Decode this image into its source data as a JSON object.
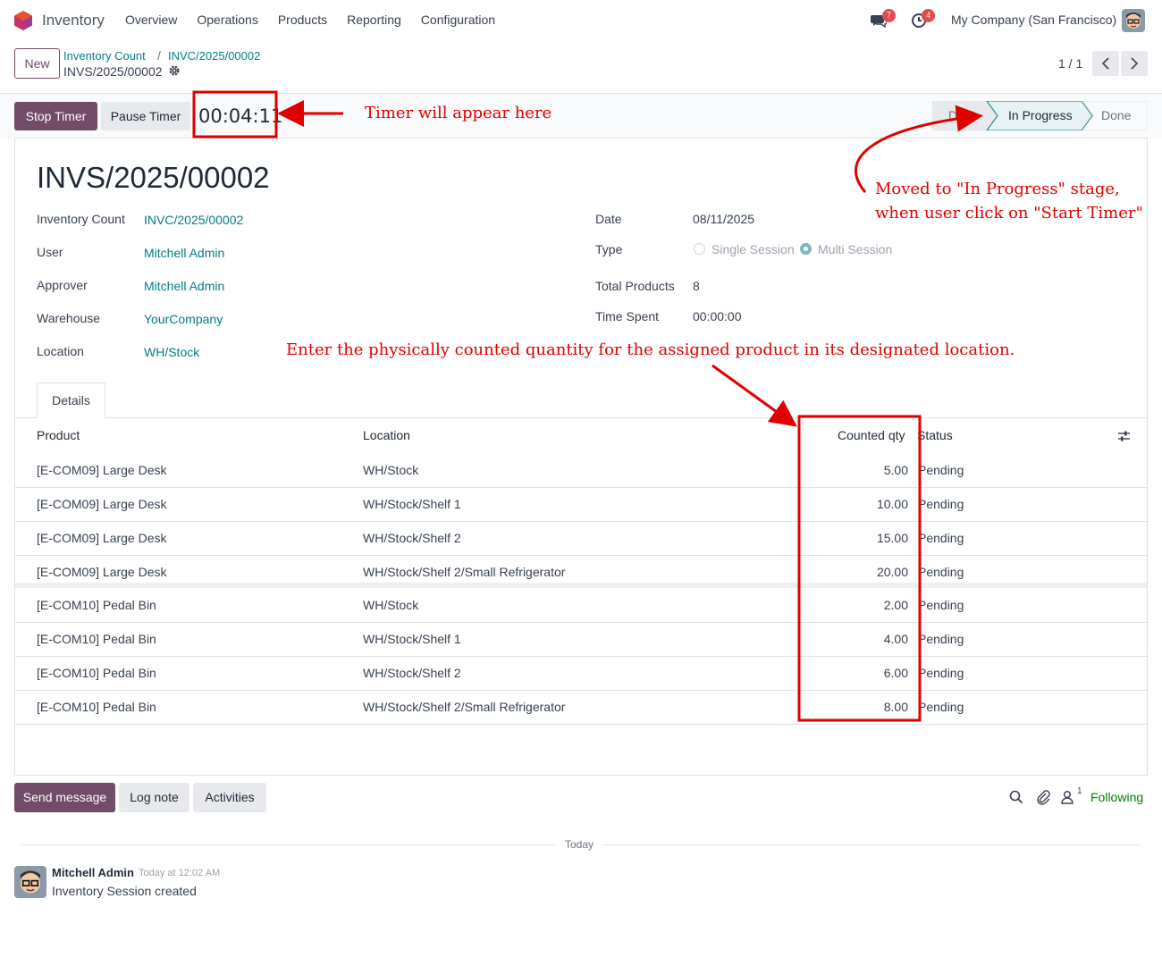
{
  "navbar": {
    "app_name": "Inventory",
    "menu": [
      "Overview",
      "Operations",
      "Products",
      "Reporting",
      "Configuration"
    ],
    "messages_badge": "7",
    "activities_badge": "4",
    "company": "My Company (San Francisco)"
  },
  "control_panel": {
    "new_label": "New",
    "breadcrumb_parent": "Inventory Count",
    "breadcrumb_child": "INVC/2025/00002",
    "record_name": "INVS/2025/00002",
    "pager": "1 / 1"
  },
  "statusbar": {
    "stop_timer": "Stop Timer",
    "pause_timer": "Pause Timer",
    "timer_value": "00:04:11",
    "stages": [
      "Draft",
      "In Progress",
      "Done"
    ],
    "active_stage": "In Progress"
  },
  "form": {
    "title": "INVS/2025/00002",
    "left_fields": [
      {
        "label": "Inventory Count",
        "value": "INVC/2025/00002"
      },
      {
        "label": "User",
        "value": "Mitchell Admin"
      },
      {
        "label": "Approver",
        "value": "Mitchell Admin"
      },
      {
        "label": "Warehouse",
        "value": "YourCompany"
      },
      {
        "label": "Location",
        "value": "WH/Stock"
      }
    ],
    "right_fields": {
      "date_label": "Date",
      "date_value": "08/11/2025",
      "type_label": "Type",
      "type_option_1": "Single Session",
      "type_option_2": "Multi Session",
      "type_selected": "Multi Session",
      "total_label": "Total Products",
      "total_value": "8",
      "time_label": "Time Spent",
      "time_value": "00:00:00"
    },
    "tab_details": "Details"
  },
  "table": {
    "headers": {
      "product": "Product",
      "location": "Location",
      "counted": "Counted qty",
      "status": "Status"
    },
    "rows": [
      {
        "product": "[E-COM09] Large Desk",
        "location": "WH/Stock",
        "counted": "5.00",
        "status": "Pending"
      },
      {
        "product": "[E-COM09] Large Desk",
        "location": "WH/Stock/Shelf 1",
        "counted": "10.00",
        "status": "Pending"
      },
      {
        "product": "[E-COM09] Large Desk",
        "location": "WH/Stock/Shelf 2",
        "counted": "15.00",
        "status": "Pending"
      },
      {
        "product": "[E-COM09] Large Desk",
        "location": "WH/Stock/Shelf 2/Small Refrigerator",
        "counted": "20.00",
        "status": "Pending"
      },
      {
        "product": "[E-COM10] Pedal Bin",
        "location": "WH/Stock",
        "counted": "2.00",
        "status": "Pending"
      },
      {
        "product": "[E-COM10] Pedal Bin",
        "location": "WH/Stock/Shelf 1",
        "counted": "4.00",
        "status": "Pending"
      },
      {
        "product": "[E-COM10] Pedal Bin",
        "location": "WH/Stock/Shelf 2",
        "counted": "6.00",
        "status": "Pending"
      },
      {
        "product": "[E-COM10] Pedal Bin",
        "location": "WH/Stock/Shelf 2/Small Refrigerator",
        "counted": "8.00",
        "status": "Pending"
      }
    ]
  },
  "chatter": {
    "send_message": "Send message",
    "log_note": "Log note",
    "activities": "Activities",
    "followers_count": "1",
    "following": "Following",
    "separator": "Today",
    "author": "Mitchell Admin",
    "time": "Today at 12:02 AM",
    "body": "Inventory Session created"
  },
  "annotations": {
    "timer_note": "Timer will appear here",
    "stage_note_line1": "Moved to \"In Progress\" stage,",
    "stage_note_line2": "when user click on \"Start Timer\"",
    "qty_note": "Enter the physically counted quantity for the assigned product in its designated location."
  },
  "colors": {
    "brand": "#714b67",
    "link": "#017e84",
    "annotation": "#e00000",
    "badge": "#e5484d",
    "following": "#008000"
  }
}
